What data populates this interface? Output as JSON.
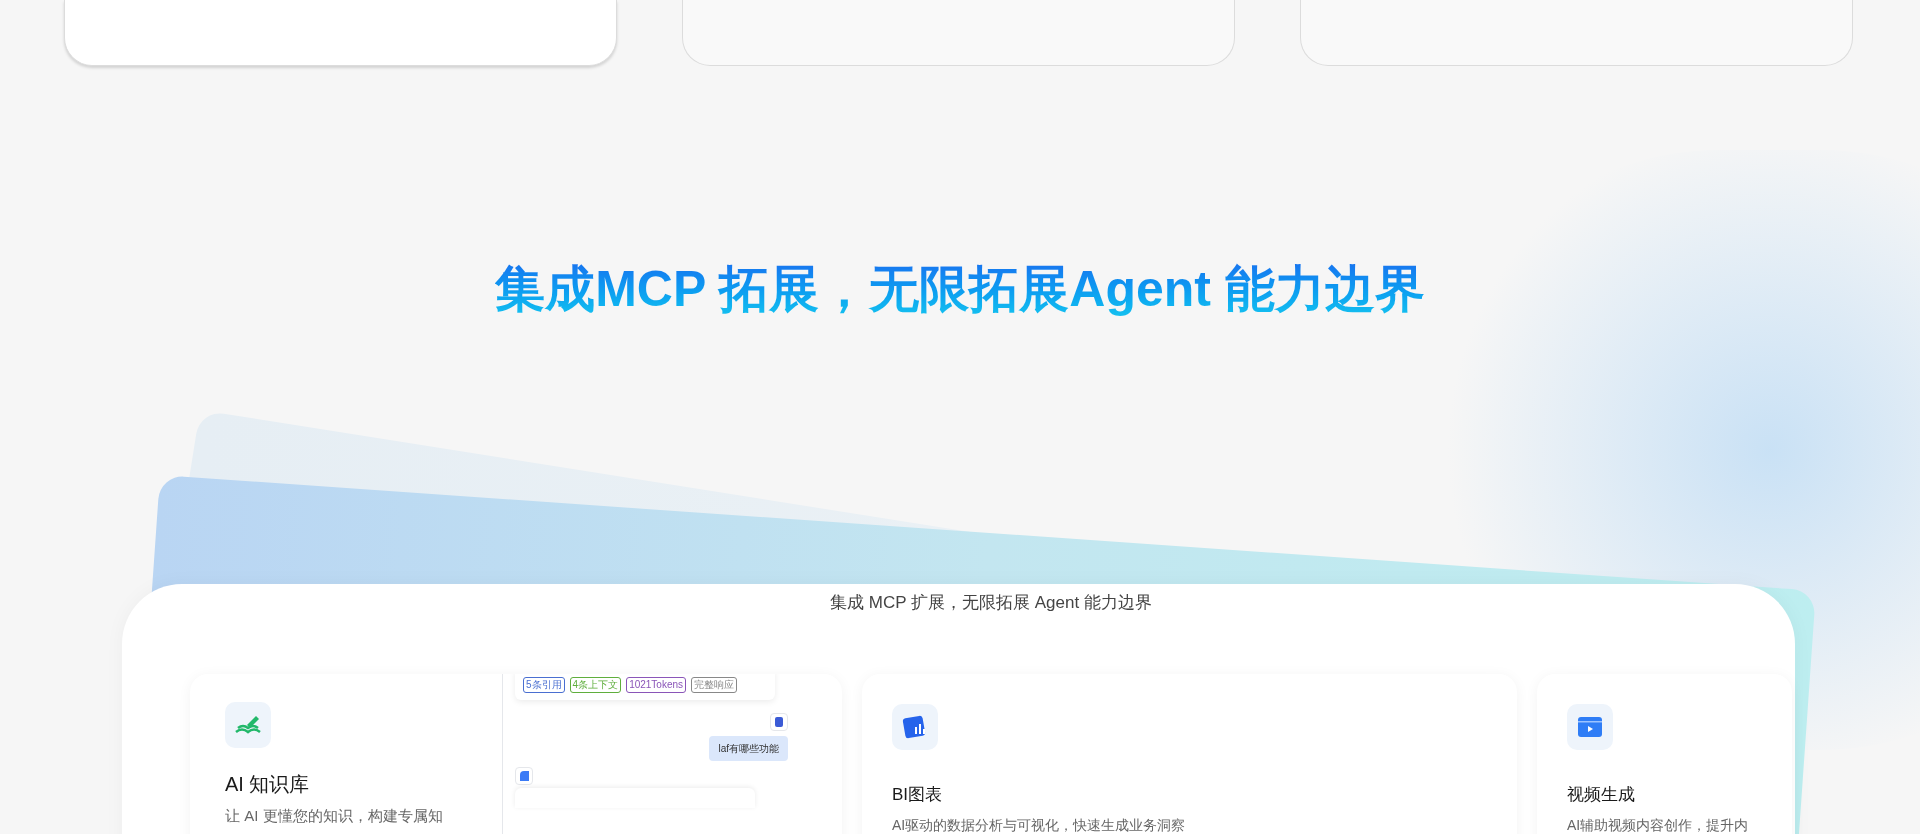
{
  "heading": "集成MCP 拓展，无限拓展Agent 能力边界",
  "showcase": {
    "caption": "集成 MCP 扩展，无限拓展 Agent 能力边界",
    "features": [
      {
        "kind": "knowledge",
        "title": "AI 知识库",
        "description": "让 AI 更懂您的知识，构建专属知",
        "preview": {
          "tags": [
            {
              "label": "5条引用",
              "color": "#4a6fd1"
            },
            {
              "label": "4条上下文",
              "color": "#5fae3c"
            },
            {
              "label": "1021Tokens",
              "color": "#8a55b8"
            },
            {
              "label": "完整响应",
              "color": "#888888"
            }
          ],
          "question": "laf有哪些功能"
        }
      },
      {
        "kind": "chart",
        "title": "BI图表",
        "description": "AI驱动的数据分析与可视化，快速生成业务洞察"
      },
      {
        "kind": "video",
        "title": "视频生成",
        "description": "AI辅助视频内容创作，提升内"
      }
    ]
  }
}
